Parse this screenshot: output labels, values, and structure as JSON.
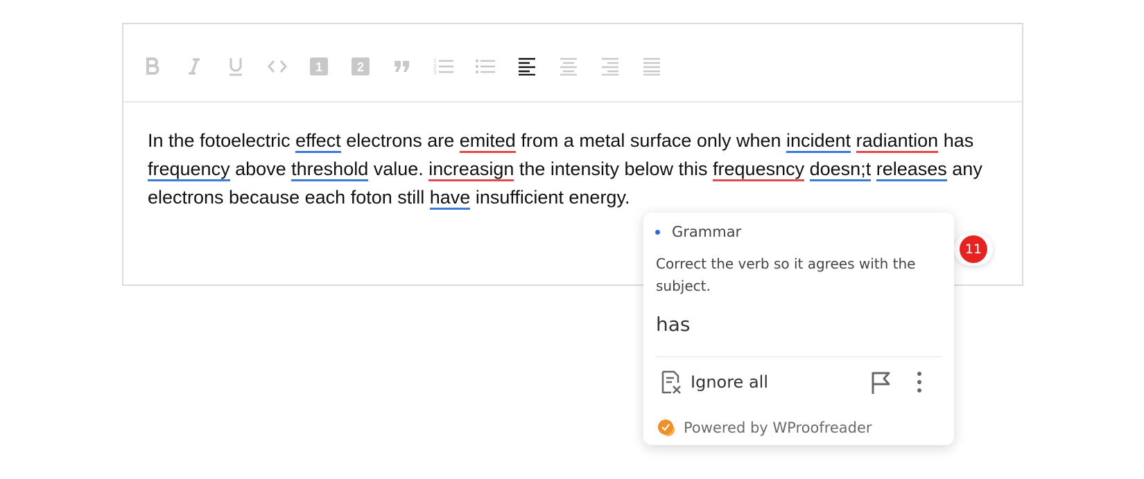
{
  "toolbar": {
    "buttons": [
      {
        "name": "bold-button",
        "icon": "bold-icon"
      },
      {
        "name": "italic-button",
        "icon": "italic-icon"
      },
      {
        "name": "underline-button",
        "icon": "underline-icon"
      },
      {
        "name": "code-button",
        "icon": "code-icon"
      },
      {
        "name": "heading-1-button",
        "icon": "heading-1-icon",
        "glyph": "1"
      },
      {
        "name": "heading-2-button",
        "icon": "heading-2-icon",
        "glyph": "2"
      },
      {
        "name": "blockquote-button",
        "icon": "quote-icon"
      },
      {
        "name": "ordered-list-button",
        "icon": "ordered-list-icon"
      },
      {
        "name": "bullet-list-button",
        "icon": "bullet-list-icon"
      },
      {
        "name": "align-left-button",
        "icon": "align-left-icon",
        "active": true
      },
      {
        "name": "align-center-button",
        "icon": "align-center-icon"
      },
      {
        "name": "align-right-button",
        "icon": "align-right-icon"
      },
      {
        "name": "justify-button",
        "icon": "justify-icon"
      }
    ],
    "inactive_color": "#c8c8c8",
    "active_color": "#111111"
  },
  "content": {
    "segments": [
      {
        "text": "In the fotoelectric "
      },
      {
        "text": "effect",
        "type": "grammar"
      },
      {
        "text": " electrons are "
      },
      {
        "text": "emited",
        "type": "spell"
      },
      {
        "text": " from a metal surface only when "
      },
      {
        "text": "incident",
        "type": "grammar"
      },
      {
        "text": " "
      },
      {
        "text": "radiantion",
        "type": "spell"
      },
      {
        "text": " has "
      },
      {
        "text": "frequency",
        "type": "grammar"
      },
      {
        "text": " above "
      },
      {
        "text": "threshold",
        "type": "grammar"
      },
      {
        "text": " value. "
      },
      {
        "text": "increasign",
        "type": "spell"
      },
      {
        "text": " the intensity below this "
      },
      {
        "text": "frequesncy",
        "type": "spell"
      },
      {
        "text": " "
      },
      {
        "text": "doesn;t",
        "type": "grammar"
      },
      {
        "text": " "
      },
      {
        "text": "releases",
        "type": "grammar"
      },
      {
        "text": " any electrons because each foton still "
      },
      {
        "text": "have",
        "type": "grammar"
      },
      {
        "text": " insufficient energy."
      }
    ]
  },
  "badge": {
    "count": "11",
    "color": "#e52421"
  },
  "popup": {
    "category": "Grammar",
    "description": "Correct the verb so it agrees with the subject.",
    "suggestion": "has",
    "ignore_label": "Ignore all",
    "powered_by": "Powered by WProofreader"
  },
  "colors": {
    "grammar": "#3a7bd5",
    "spelling": "#e5484d",
    "logo": "#f0902a"
  }
}
